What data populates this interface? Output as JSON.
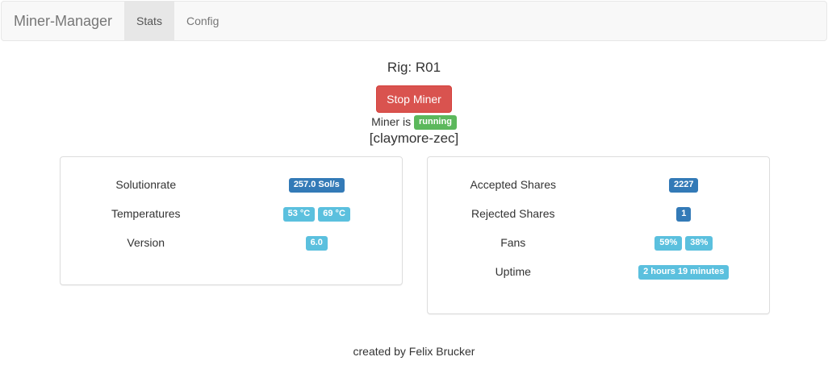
{
  "navbar": {
    "brand": "Miner-Manager",
    "tabs": [
      {
        "label": "Stats",
        "active": true
      },
      {
        "label": "Config",
        "active": false
      }
    ]
  },
  "rig": {
    "title": "Rig: R01",
    "stop_button_label": "Stop Miner",
    "status_prefix": "Miner is",
    "status_badge": "running",
    "miner_name": "[claymore-zec]"
  },
  "left_panel": {
    "solutionrate": {
      "label": "Solutionrate",
      "value": "257.0 Sol/s"
    },
    "temperatures": {
      "label": "Temperatures",
      "values": [
        "53 °C",
        "69 °C"
      ]
    },
    "version": {
      "label": "Version",
      "value": "6.0"
    }
  },
  "right_panel": {
    "accepted": {
      "label": "Accepted Shares",
      "value": "2227"
    },
    "rejected": {
      "label": "Rejected Shares",
      "value": "1"
    },
    "fans": {
      "label": "Fans",
      "values": [
        "59%",
        "38%"
      ]
    },
    "uptime": {
      "label": "Uptime",
      "value": "2 hours 19 minutes"
    }
  },
  "footer": {
    "text": "created by Felix Brucker"
  },
  "colors": {
    "danger": "#d9534f",
    "success": "#5cb85c",
    "primary": "#337ab7",
    "info": "#5bc0de",
    "navbar_bg": "#f8f8f8",
    "nav_active_bg": "#e7e7e7"
  }
}
